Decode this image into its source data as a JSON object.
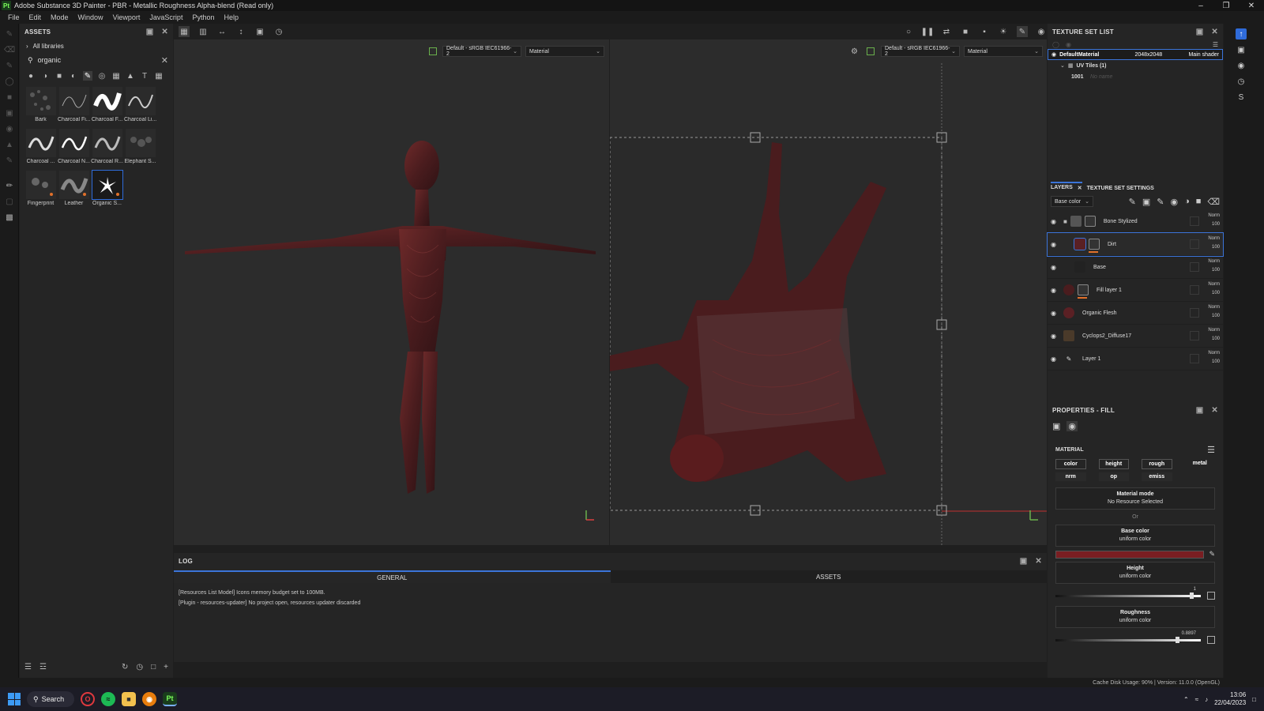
{
  "window": {
    "title": "Adobe Substance 3D Painter - PBR - Metallic Roughness Alpha-blend (Read only)",
    "app_badge": "Pt"
  },
  "menu": [
    "File",
    "Edit",
    "Mode",
    "Window",
    "Viewport",
    "JavaScript",
    "Python",
    "Help"
  ],
  "assets": {
    "title": "ASSETS",
    "library": "All libraries",
    "search_value": "organic",
    "items": [
      {
        "label": "Bark"
      },
      {
        "label": "Charcoal Fi..."
      },
      {
        "label": "Charcoal F..."
      },
      {
        "label": "Charcoal Li..."
      },
      {
        "label": "Charcoal ..."
      },
      {
        "label": "Charcoal N..."
      },
      {
        "label": "Charcoal R..."
      },
      {
        "label": "Elephant S..."
      },
      {
        "label": "Fingerprint"
      },
      {
        "label": "Leather"
      },
      {
        "label": "Organic S..."
      }
    ]
  },
  "viewport": {
    "left": {
      "colorspace": "Default - sRGB IEC61966-2",
      "channel": "Material"
    },
    "right": {
      "colorspace": "Default - sRGB IEC61966-2",
      "channel": "Material"
    }
  },
  "log": {
    "title": "LOG",
    "tabs": [
      "GENERAL",
      "ASSETS"
    ],
    "lines": [
      "[Resources List Model] Icons memory budget set to 100MB.",
      "[Plugin - resources-updater] No project open, resources updater discarded"
    ]
  },
  "texture_set": {
    "title": "TEXTURE SET LIST",
    "name": "DefaultMaterial",
    "resolution": "2048x2048",
    "shader": "Main shader",
    "uv_tiles": "UV Tiles (1)",
    "tile_id": "1001",
    "tile_name": "No name"
  },
  "layers": {
    "tabs": [
      "LAYERS",
      "TEXTURE SET SETTINGS"
    ],
    "channel": "Base color",
    "items": [
      {
        "name": "Bone Stylized",
        "blend": "Norm",
        "opacity": "100"
      },
      {
        "name": "Dirt",
        "blend": "Norm",
        "opacity": "100"
      },
      {
        "name": "Base",
        "blend": "Norm",
        "opacity": "100"
      },
      {
        "name": "Fill layer 1",
        "blend": "Norm",
        "opacity": "100"
      },
      {
        "name": "Organic Flesh",
        "blend": "Norm",
        "opacity": "100"
      },
      {
        "name": "Cyclops2_Diffuse17",
        "blend": "Norm",
        "opacity": "100"
      },
      {
        "name": "Layer 1",
        "blend": "Norm",
        "opacity": "100"
      }
    ]
  },
  "properties": {
    "title": "PROPERTIES - FILL",
    "section": "MATERIAL",
    "channels": [
      "color",
      "height",
      "rough",
      "metal",
      "nrm",
      "op",
      "emiss"
    ],
    "material_mode_label": "Material mode",
    "material_mode_value": "No Resource Selected",
    "or": "Or",
    "base_color_label": "Base color",
    "base_color_sub": "uniform color",
    "base_color_hex": "#7a1e22",
    "height_label": "Height",
    "height_sub": "uniform color",
    "height_value": "1",
    "roughness_label": "Roughness",
    "roughness_sub": "uniform color",
    "roughness_value": "0.8897"
  },
  "status": {
    "text": "Cache Disk Usage:   90% | Version: 11.0.0 (OpenGL)"
  },
  "taskbar": {
    "search": "Search",
    "time": "13:06",
    "date": "22/04/2023"
  }
}
